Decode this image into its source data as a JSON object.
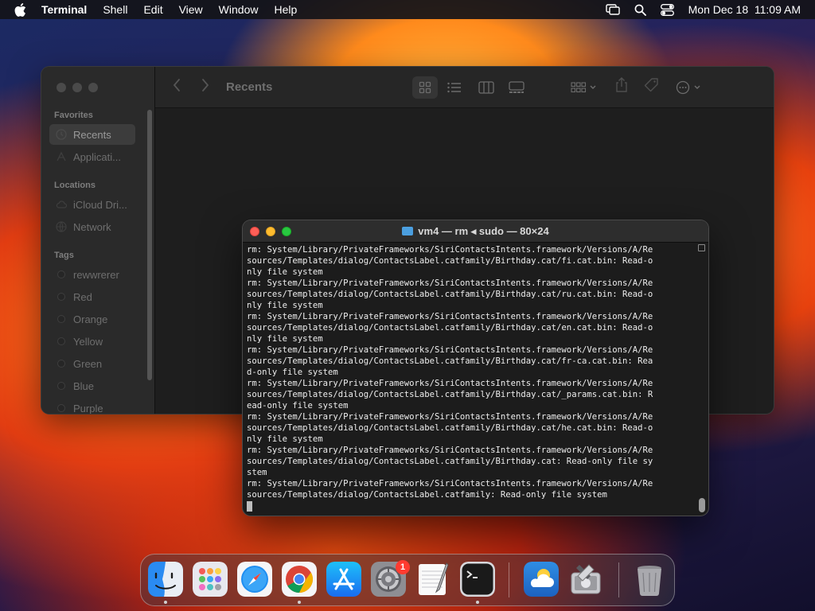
{
  "menubar": {
    "app_name": "Terminal",
    "items": [
      "Shell",
      "Edit",
      "View",
      "Window",
      "Help"
    ],
    "clock": "Mon Dec 18  11:09 AM"
  },
  "finder": {
    "title": "Recents",
    "favorites_label": "Favorites",
    "locations_label": "Locations",
    "tags_label": "Tags",
    "favorites": [
      "Recents",
      "Applicati..."
    ],
    "locations": [
      "iCloud Dri...",
      "Network"
    ],
    "tags": [
      "rewwrerer",
      "Red",
      "Orange",
      "Yellow",
      "Green",
      "Blue",
      "Purple"
    ]
  },
  "terminal": {
    "title": "vm4 — rm ◂ sudo — 80×24",
    "lines": [
      "rm: System/Library/PrivateFrameworks/SiriContactsIntents.framework/Versions/A/Re",
      "sources/Templates/dialog/ContactsLabel.catfamily/Birthday.cat/fi.cat.bin: Read-o",
      "nly file system",
      "rm: System/Library/PrivateFrameworks/SiriContactsIntents.framework/Versions/A/Re",
      "sources/Templates/dialog/ContactsLabel.catfamily/Birthday.cat/ru.cat.bin: Read-o",
      "nly file system",
      "rm: System/Library/PrivateFrameworks/SiriContactsIntents.framework/Versions/A/Re",
      "sources/Templates/dialog/ContactsLabel.catfamily/Birthday.cat/en.cat.bin: Read-o",
      "nly file system",
      "rm: System/Library/PrivateFrameworks/SiriContactsIntents.framework/Versions/A/Re",
      "sources/Templates/dialog/ContactsLabel.catfamily/Birthday.cat/fr-ca.cat.bin: Rea",
      "d-only file system",
      "rm: System/Library/PrivateFrameworks/SiriContactsIntents.framework/Versions/A/Re",
      "sources/Templates/dialog/ContactsLabel.catfamily/Birthday.cat/_params.cat.bin: R",
      "ead-only file system",
      "rm: System/Library/PrivateFrameworks/SiriContactsIntents.framework/Versions/A/Re",
      "sources/Templates/dialog/ContactsLabel.catfamily/Birthday.cat/he.cat.bin: Read-o",
      "nly file system",
      "rm: System/Library/PrivateFrameworks/SiriContactsIntents.framework/Versions/A/Re",
      "sources/Templates/dialog/ContactsLabel.catfamily/Birthday.cat: Read-only file sy",
      "stem",
      "rm: System/Library/PrivateFrameworks/SiriContactsIntents.framework/Versions/A/Re",
      "sources/Templates/dialog/ContactsLabel.catfamily: Read-only file system"
    ]
  },
  "dock": {
    "apps": [
      "finder-icon",
      "launchpad-icon",
      "safari-icon",
      "chrome-icon",
      "app-store-icon",
      "system-settings-icon",
      "textedit-icon",
      "terminal-icon",
      "weather-icon",
      "disk-utility-icon",
      "trash-icon"
    ],
    "settings_badge": "1"
  },
  "colors": {
    "close": "#ff5f57",
    "minimize": "#febc2e",
    "zoom": "#28c840",
    "badge": "#ff3b30"
  }
}
